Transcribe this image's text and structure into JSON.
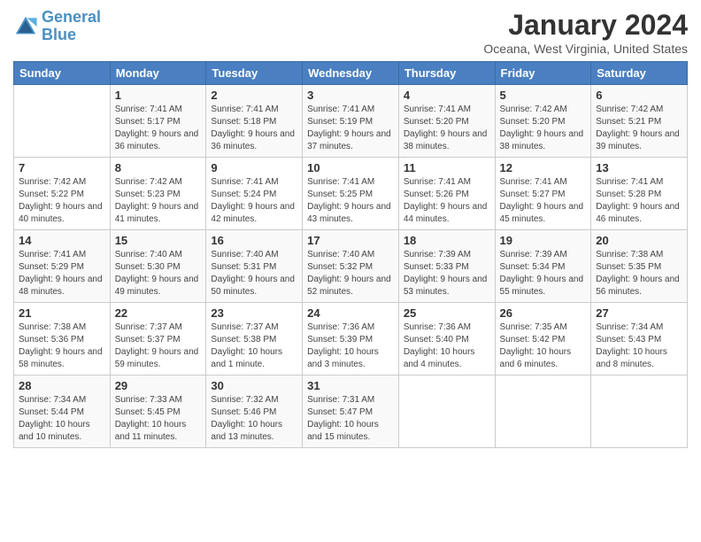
{
  "logo": {
    "line1": "General",
    "line2": "Blue"
  },
  "title": "January 2024",
  "subtitle": "Oceana, West Virginia, United States",
  "days_of_week": [
    "Sunday",
    "Monday",
    "Tuesday",
    "Wednesday",
    "Thursday",
    "Friday",
    "Saturday"
  ],
  "weeks": [
    [
      {
        "num": "",
        "text": ""
      },
      {
        "num": "1",
        "text": "Sunrise: 7:41 AM\nSunset: 5:17 PM\nDaylight: 9 hours and 36 minutes."
      },
      {
        "num": "2",
        "text": "Sunrise: 7:41 AM\nSunset: 5:18 PM\nDaylight: 9 hours and 36 minutes."
      },
      {
        "num": "3",
        "text": "Sunrise: 7:41 AM\nSunset: 5:19 PM\nDaylight: 9 hours and 37 minutes."
      },
      {
        "num": "4",
        "text": "Sunrise: 7:41 AM\nSunset: 5:20 PM\nDaylight: 9 hours and 38 minutes."
      },
      {
        "num": "5",
        "text": "Sunrise: 7:42 AM\nSunset: 5:20 PM\nDaylight: 9 hours and 38 minutes."
      },
      {
        "num": "6",
        "text": "Sunrise: 7:42 AM\nSunset: 5:21 PM\nDaylight: 9 hours and 39 minutes."
      }
    ],
    [
      {
        "num": "7",
        "text": "Sunrise: 7:42 AM\nSunset: 5:22 PM\nDaylight: 9 hours and 40 minutes."
      },
      {
        "num": "8",
        "text": "Sunrise: 7:42 AM\nSunset: 5:23 PM\nDaylight: 9 hours and 41 minutes."
      },
      {
        "num": "9",
        "text": "Sunrise: 7:41 AM\nSunset: 5:24 PM\nDaylight: 9 hours and 42 minutes."
      },
      {
        "num": "10",
        "text": "Sunrise: 7:41 AM\nSunset: 5:25 PM\nDaylight: 9 hours and 43 minutes."
      },
      {
        "num": "11",
        "text": "Sunrise: 7:41 AM\nSunset: 5:26 PM\nDaylight: 9 hours and 44 minutes."
      },
      {
        "num": "12",
        "text": "Sunrise: 7:41 AM\nSunset: 5:27 PM\nDaylight: 9 hours and 45 minutes."
      },
      {
        "num": "13",
        "text": "Sunrise: 7:41 AM\nSunset: 5:28 PM\nDaylight: 9 hours and 46 minutes."
      }
    ],
    [
      {
        "num": "14",
        "text": "Sunrise: 7:41 AM\nSunset: 5:29 PM\nDaylight: 9 hours and 48 minutes."
      },
      {
        "num": "15",
        "text": "Sunrise: 7:40 AM\nSunset: 5:30 PM\nDaylight: 9 hours and 49 minutes."
      },
      {
        "num": "16",
        "text": "Sunrise: 7:40 AM\nSunset: 5:31 PM\nDaylight: 9 hours and 50 minutes."
      },
      {
        "num": "17",
        "text": "Sunrise: 7:40 AM\nSunset: 5:32 PM\nDaylight: 9 hours and 52 minutes."
      },
      {
        "num": "18",
        "text": "Sunrise: 7:39 AM\nSunset: 5:33 PM\nDaylight: 9 hours and 53 minutes."
      },
      {
        "num": "19",
        "text": "Sunrise: 7:39 AM\nSunset: 5:34 PM\nDaylight: 9 hours and 55 minutes."
      },
      {
        "num": "20",
        "text": "Sunrise: 7:38 AM\nSunset: 5:35 PM\nDaylight: 9 hours and 56 minutes."
      }
    ],
    [
      {
        "num": "21",
        "text": "Sunrise: 7:38 AM\nSunset: 5:36 PM\nDaylight: 9 hours and 58 minutes."
      },
      {
        "num": "22",
        "text": "Sunrise: 7:37 AM\nSunset: 5:37 PM\nDaylight: 9 hours and 59 minutes."
      },
      {
        "num": "23",
        "text": "Sunrise: 7:37 AM\nSunset: 5:38 PM\nDaylight: 10 hours and 1 minute."
      },
      {
        "num": "24",
        "text": "Sunrise: 7:36 AM\nSunset: 5:39 PM\nDaylight: 10 hours and 3 minutes."
      },
      {
        "num": "25",
        "text": "Sunrise: 7:36 AM\nSunset: 5:40 PM\nDaylight: 10 hours and 4 minutes."
      },
      {
        "num": "26",
        "text": "Sunrise: 7:35 AM\nSunset: 5:42 PM\nDaylight: 10 hours and 6 minutes."
      },
      {
        "num": "27",
        "text": "Sunrise: 7:34 AM\nSunset: 5:43 PM\nDaylight: 10 hours and 8 minutes."
      }
    ],
    [
      {
        "num": "28",
        "text": "Sunrise: 7:34 AM\nSunset: 5:44 PM\nDaylight: 10 hours and 10 minutes."
      },
      {
        "num": "29",
        "text": "Sunrise: 7:33 AM\nSunset: 5:45 PM\nDaylight: 10 hours and 11 minutes."
      },
      {
        "num": "30",
        "text": "Sunrise: 7:32 AM\nSunset: 5:46 PM\nDaylight: 10 hours and 13 minutes."
      },
      {
        "num": "31",
        "text": "Sunrise: 7:31 AM\nSunset: 5:47 PM\nDaylight: 10 hours and 15 minutes."
      },
      {
        "num": "",
        "text": ""
      },
      {
        "num": "",
        "text": ""
      },
      {
        "num": "",
        "text": ""
      }
    ]
  ]
}
